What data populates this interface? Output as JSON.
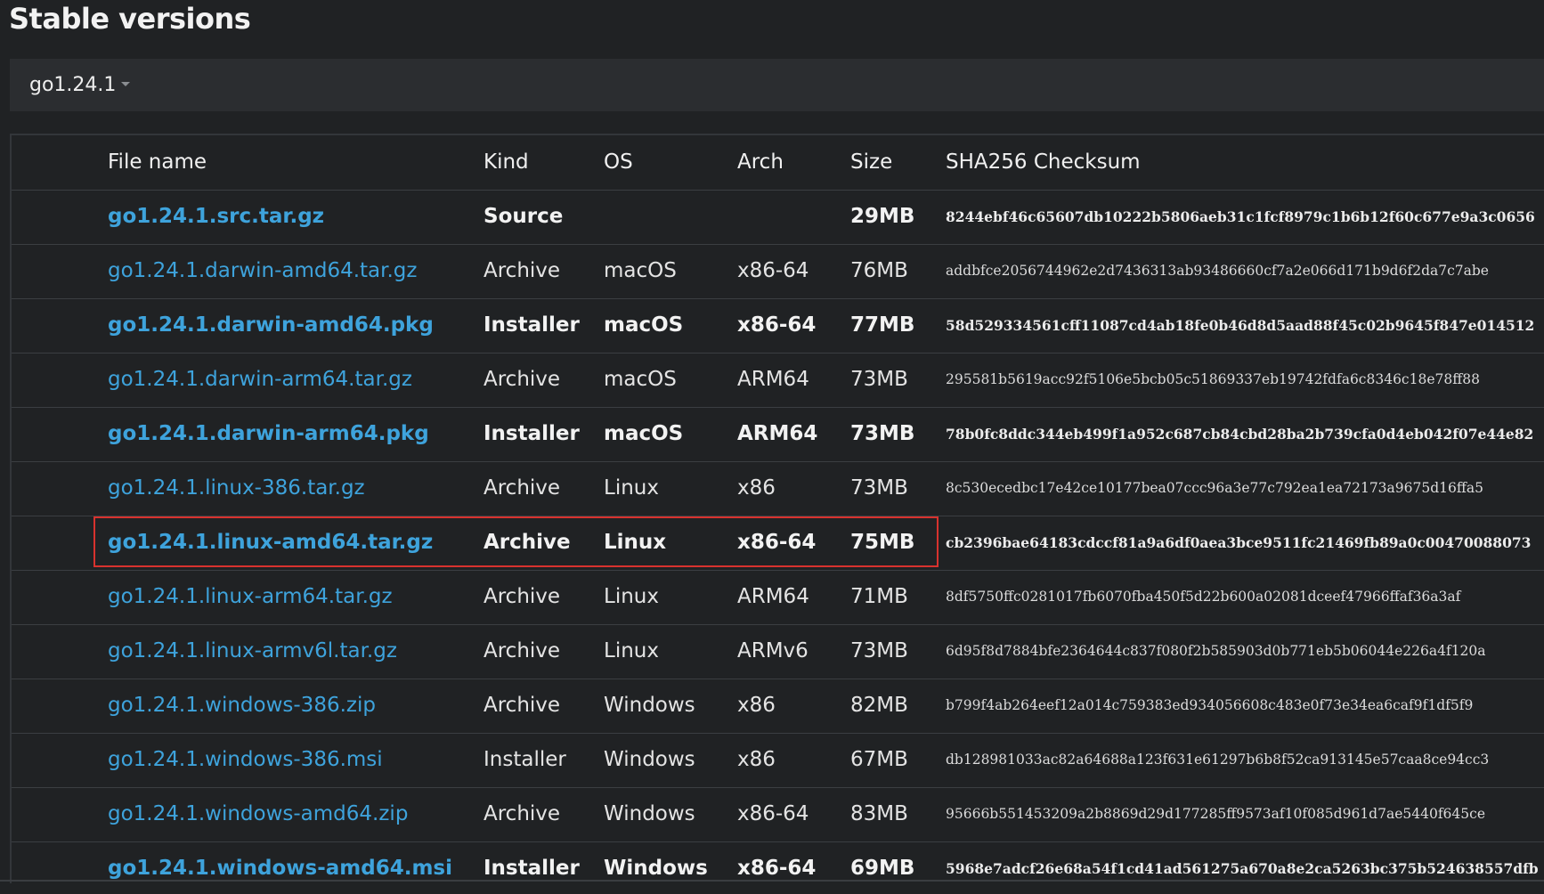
{
  "page": {
    "heading": "Stable versions"
  },
  "version_selector": {
    "selected": "go1.24.1"
  },
  "table": {
    "headers": {
      "file_name": "File name",
      "kind": "Kind",
      "os": "OS",
      "arch": "Arch",
      "size": "Size",
      "checksum": "SHA256 Checksum"
    },
    "rows": [
      {
        "file": "go1.24.1.src.tar.gz",
        "kind": "Source",
        "os": "",
        "arch": "",
        "size": "29MB",
        "checksum": "8244ebf46c65607db10222b5806aeb31c1fcf8979c1b6b12f60c677e9a3c0656",
        "bold": true
      },
      {
        "file": "go1.24.1.darwin-amd64.tar.gz",
        "kind": "Archive",
        "os": "macOS",
        "arch": "x86-64",
        "size": "76MB",
        "checksum": "addbfce2056744962e2d7436313ab93486660cf7a2e066d171b9d6f2da7c7abe",
        "bold": false
      },
      {
        "file": "go1.24.1.darwin-amd64.pkg",
        "kind": "Installer",
        "os": "macOS",
        "arch": "x86-64",
        "size": "77MB",
        "checksum": "58d529334561cff11087cd4ab18fe0b46d8d5aad88f45c02b9645f847e014512",
        "bold": true
      },
      {
        "file": "go1.24.1.darwin-arm64.tar.gz",
        "kind": "Archive",
        "os": "macOS",
        "arch": "ARM64",
        "size": "73MB",
        "checksum": "295581b5619acc92f5106e5bcb05c51869337eb19742fdfa6c8346c18e78ff88",
        "bold": false
      },
      {
        "file": "go1.24.1.darwin-arm64.pkg",
        "kind": "Installer",
        "os": "macOS",
        "arch": "ARM64",
        "size": "73MB",
        "checksum": "78b0fc8ddc344eb499f1a952c687cb84cbd28ba2b739cfa0d4eb042f07e44e82",
        "bold": true
      },
      {
        "file": "go1.24.1.linux-386.tar.gz",
        "kind": "Archive",
        "os": "Linux",
        "arch": "x86",
        "size": "73MB",
        "checksum": "8c530ecedbc17e42ce10177bea07ccc96a3e77c792ea1ea72173a9675d16ffa5",
        "bold": false
      },
      {
        "file": "go1.24.1.linux-amd64.tar.gz",
        "kind": "Archive",
        "os": "Linux",
        "arch": "x86-64",
        "size": "75MB",
        "checksum": "cb2396bae64183cdccf81a9a6df0aea3bce9511fc21469fb89a0c00470088073",
        "bold": true
      },
      {
        "file": "go1.24.1.linux-arm64.tar.gz",
        "kind": "Archive",
        "os": "Linux",
        "arch": "ARM64",
        "size": "71MB",
        "checksum": "8df5750ffc0281017fb6070fba450f5d22b600a02081dceef47966ffaf36a3af",
        "bold": false
      },
      {
        "file": "go1.24.1.linux-armv6l.tar.gz",
        "kind": "Archive",
        "os": "Linux",
        "arch": "ARMv6",
        "size": "73MB",
        "checksum": "6d95f8d7884bfe2364644c837f080f2b585903d0b771eb5b06044e226a4f120a",
        "bold": false
      },
      {
        "file": "go1.24.1.windows-386.zip",
        "kind": "Archive",
        "os": "Windows",
        "arch": "x86",
        "size": "82MB",
        "checksum": "b799f4ab264eef12a014c759383ed934056608c483e0f73e34ea6caf9f1df5f9",
        "bold": false
      },
      {
        "file": "go1.24.1.windows-386.msi",
        "kind": "Installer",
        "os": "Windows",
        "arch": "x86",
        "size": "67MB",
        "checksum": "db128981033ac82a64688a123f631e61297b6b8f52ca913145e57caa8ce94cc3",
        "bold": false
      },
      {
        "file": "go1.24.1.windows-amd64.zip",
        "kind": "Archive",
        "os": "Windows",
        "arch": "x86-64",
        "size": "83MB",
        "checksum": "95666b551453209a2b8869d29d177285ff9573af10f085d961d7ae5440f645ce",
        "bold": false
      },
      {
        "file": "go1.24.1.windows-amd64.msi",
        "kind": "Installer",
        "os": "Windows",
        "arch": "x86-64",
        "size": "69MB",
        "checksum": "5968e7adcf26e68a54f1cd41ad561275a670a8e2ca5263bc375b524638557dfb",
        "bold": true
      }
    ]
  },
  "highlight": {
    "row_file": "go1.24.1.linux-amd64.tar.gz",
    "color": "#d8322e"
  },
  "colors": {
    "background": "#202224",
    "link": "#3ea3dc",
    "selector_bar": "#2b2d30"
  }
}
